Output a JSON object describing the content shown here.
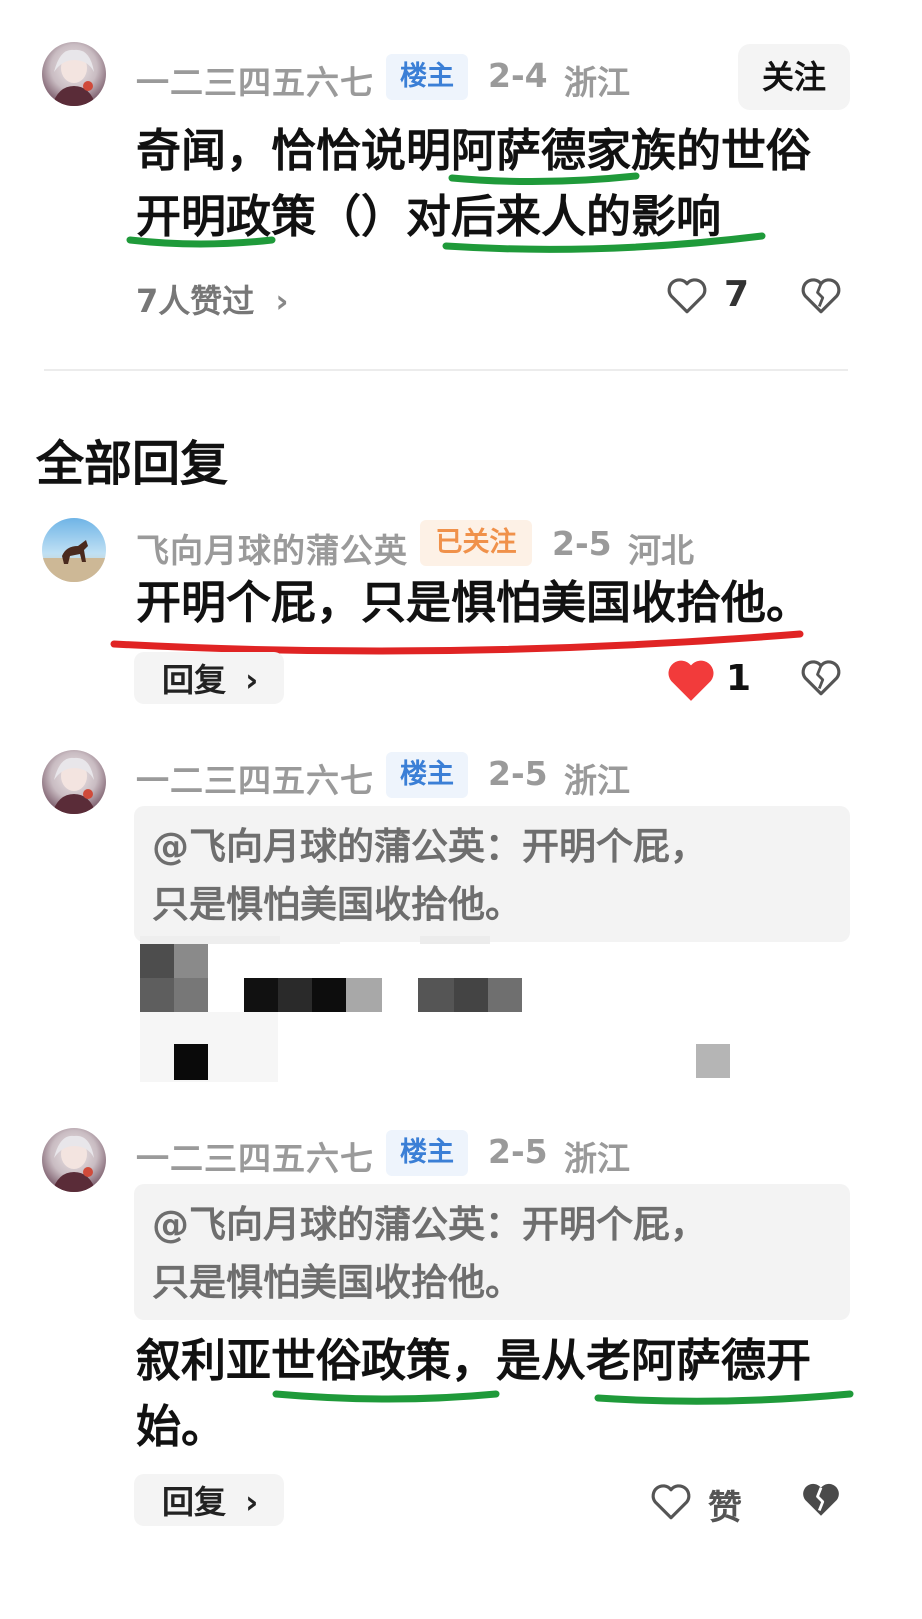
{
  "post": {
    "author": "一二三四五六七",
    "badge": "楼主",
    "date": "2-4",
    "location": "浙江",
    "follow_label": "关注",
    "line1": "奇闻，恰恰说明阿萨德家族的世俗",
    "line2": "开明政策（）对后来人的影响",
    "likes_text": "7人赞过",
    "like_count": "7"
  },
  "section_title": "全部回复",
  "replies": [
    {
      "author": "飞向月球的蒲公英",
      "badge": "已关注",
      "date": "2-5",
      "location": "河北",
      "text": "开明个屁，只是惧怕美国收拾他。",
      "reply_label": "回复",
      "like_count": "1"
    },
    {
      "author": "一二三四五六七",
      "badge": "楼主",
      "date": "2-5",
      "location": "浙江",
      "quote_line1": "@飞向月球的蒲公英：开明个屁，",
      "quote_line2": "只是惧怕美国收拾他。"
    },
    {
      "author": "一二三四五六七",
      "badge": "楼主",
      "date": "2-5",
      "location": "浙江",
      "quote_line1": "@飞向月球的蒲公英：开明个屁，",
      "quote_line2": "只是惧怕美国收拾他。",
      "line1": "叙利亚世俗政策，是从老阿萨德开",
      "line2": "始。",
      "reply_label": "回复",
      "like_label": "赞"
    }
  ],
  "colors": {
    "green_underline": "#1f9a3a",
    "red_underline": "#e02424",
    "heart_red": "#f23b3b"
  }
}
